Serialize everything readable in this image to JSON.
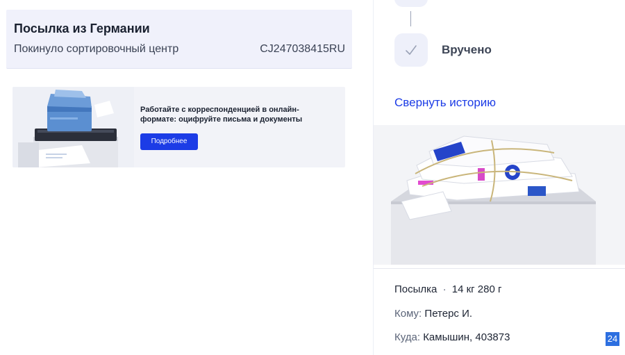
{
  "parcel": {
    "title": "Посылка из Германии",
    "status": "Покинуло сортировочный центр",
    "tracking": "CJ247038415RU"
  },
  "banner": {
    "text": "Работайте с корреспонденцией в онлайн-формате: оцифруйте письма и документы",
    "button_label": "Подробнее"
  },
  "history": {
    "last_step_icon": "check-icon",
    "last_step_label": "Вручено",
    "collapse_label": "Свернуть историю"
  },
  "details": {
    "type": "Посылка",
    "separator": "·",
    "weight": "14 кг 280 г",
    "recipient_label": "Кому:",
    "recipient": "Петерс И.",
    "destination_label": "Куда:",
    "destination": "Камышин, 403873"
  },
  "page_badge": "24",
  "colors": {
    "accent": "#1c3ce6",
    "card_bg": "#f0f1fb",
    "badge": "#2d6fe0"
  }
}
